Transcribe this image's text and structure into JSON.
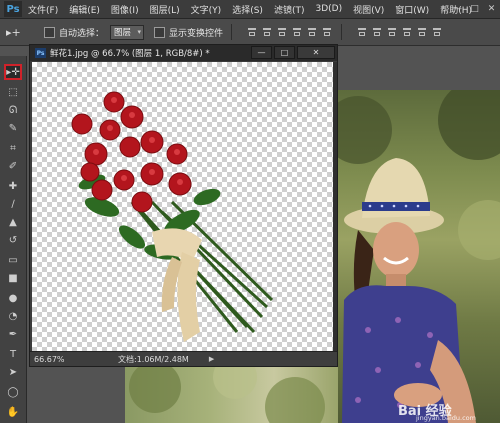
{
  "menubar": {
    "logo": "Ps",
    "items": [
      "文件(F)",
      "编辑(E)",
      "图像(I)",
      "图层(L)",
      "文字(Y)",
      "选择(S)",
      "滤镜(T)",
      "3D(D)",
      "视图(V)",
      "窗口(W)",
      "帮助(H)"
    ],
    "window_controls": [
      "—",
      "□",
      "✕"
    ]
  },
  "options": {
    "tool_glyph": "▸+",
    "auto_select_label": "自动选择：",
    "layer_select_value": "图层",
    "show_transform_label": "显示变换控件"
  },
  "toolbar": {
    "tools": [
      {
        "name": "move-tool",
        "glyph": "▸✛",
        "active": true
      },
      {
        "name": "marquee-tool",
        "glyph": "⬚"
      },
      {
        "name": "lasso-tool",
        "glyph": "ᘏ"
      },
      {
        "name": "quick-select-tool",
        "glyph": "✎"
      },
      {
        "name": "crop-tool",
        "glyph": "⌗"
      },
      {
        "name": "eyedropper-tool",
        "glyph": "✐"
      },
      {
        "name": "healing-tool",
        "glyph": "✚"
      },
      {
        "name": "brush-tool",
        "glyph": "∕"
      },
      {
        "name": "stamp-tool",
        "glyph": "▲"
      },
      {
        "name": "history-brush-tool",
        "glyph": "↺"
      },
      {
        "name": "eraser-tool",
        "glyph": "▭"
      },
      {
        "name": "gradient-tool",
        "glyph": "■"
      },
      {
        "name": "blur-tool",
        "glyph": "●"
      },
      {
        "name": "dodge-tool",
        "glyph": "◔"
      },
      {
        "name": "pen-tool",
        "glyph": "✒"
      },
      {
        "name": "type-tool",
        "glyph": "T"
      },
      {
        "name": "path-select-tool",
        "glyph": "➤"
      },
      {
        "name": "shape-tool",
        "glyph": "◯"
      },
      {
        "name": "hand-tool",
        "glyph": "✋"
      }
    ]
  },
  "document": {
    "ps_badge": "Ps",
    "title": "鲜花1.jpg @ 66.7% (图层 1, RGB/8#) *",
    "btn_min": "—",
    "btn_max": "□",
    "btn_close": "✕",
    "zoom": "66.67%",
    "doc_info": "文档:1.06M/2.48M",
    "status_arrow": "▶"
  },
  "watermark": {
    "main": "Bai 经验",
    "url": "jingyan.baidu.com"
  },
  "colors": {
    "highlight": "#d0222a",
    "rose": "#b3151d",
    "ribbon": "#e8d6b0"
  }
}
